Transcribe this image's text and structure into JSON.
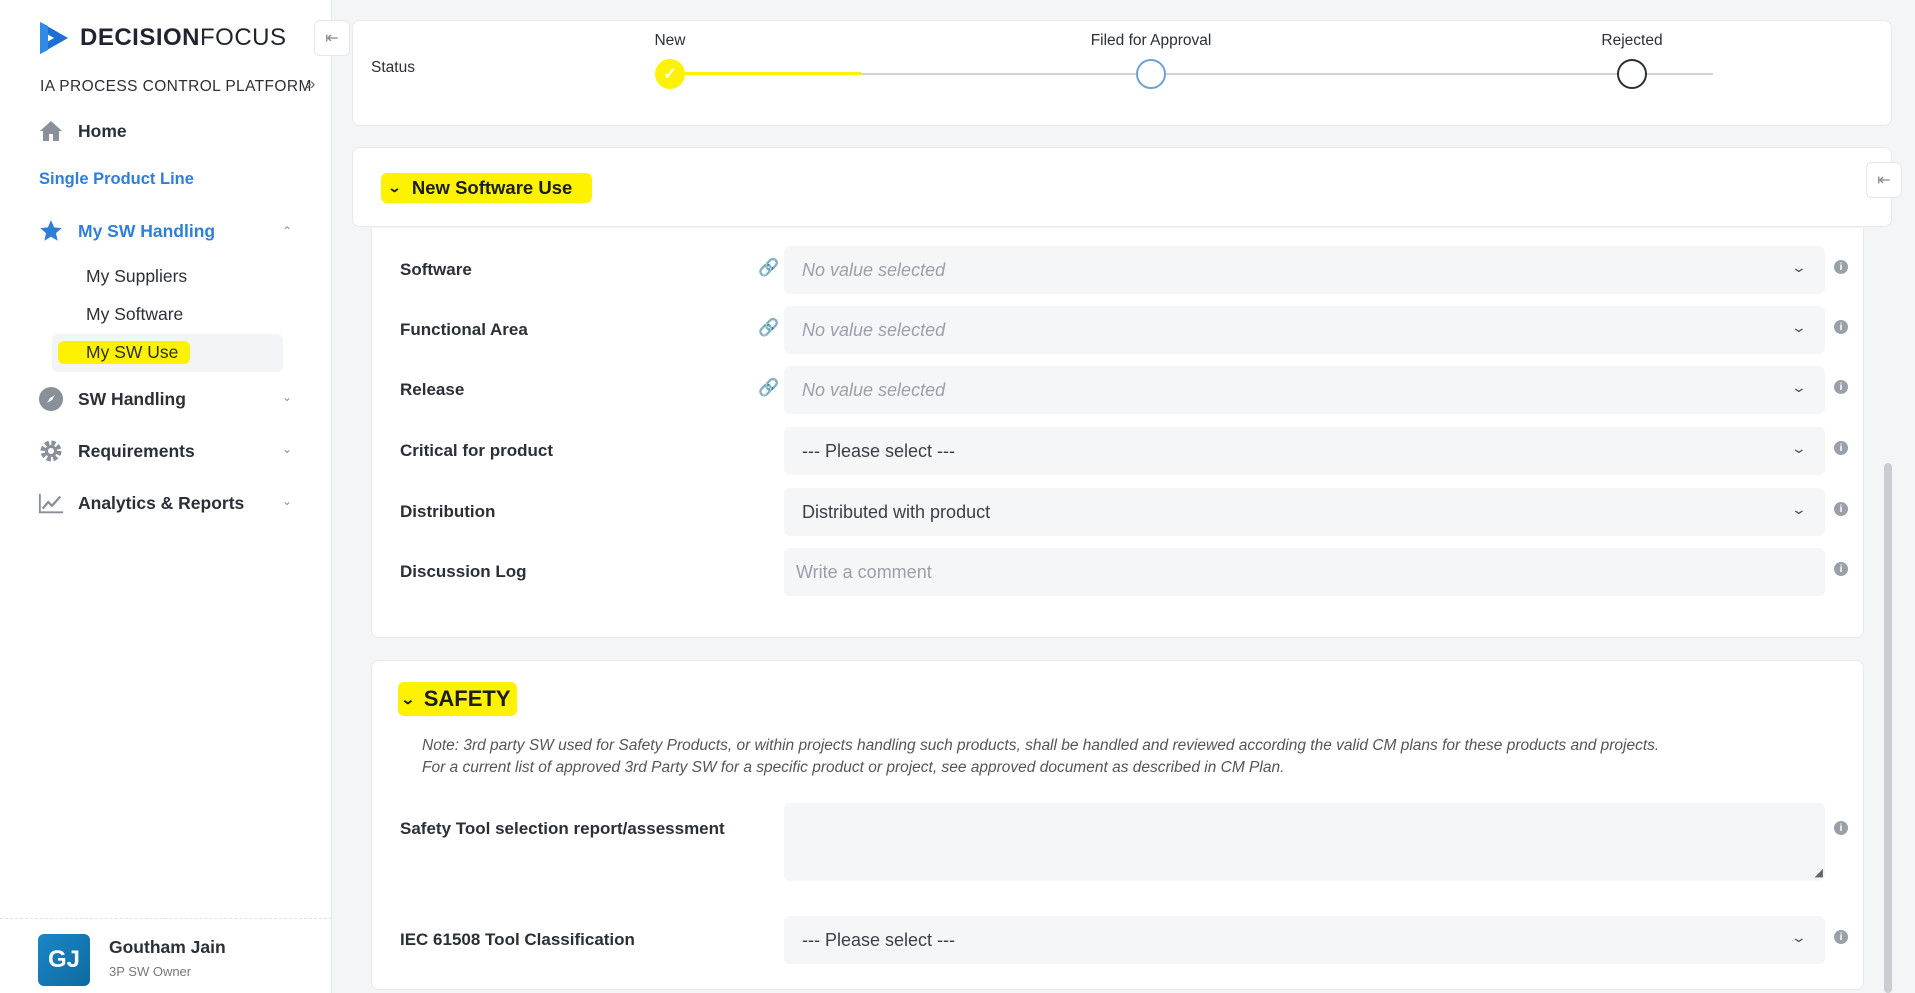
{
  "brand": {
    "bold": "DECISION",
    "light": "FOCUS"
  },
  "sidebar": {
    "platform": "IA PROCESS CONTROL PLATFORM",
    "home": "Home",
    "section_link": "Single Product Line",
    "my_sw_handling": "My SW Handling",
    "sub_items": [
      "My Suppliers",
      "My Software",
      "My SW Use"
    ],
    "sw_handling": "SW Handling",
    "requirements": "Requirements",
    "analytics": "Analytics & Reports"
  },
  "user": {
    "initials": "GJ",
    "name": "Goutham Jain",
    "role": "3P SW Owner"
  },
  "status": {
    "label": "Status",
    "steps": [
      "New",
      "Filed for Approval",
      "Rejected"
    ],
    "current_step": 0
  },
  "section": {
    "title": "New Software Use"
  },
  "form": {
    "software": {
      "label": "Software",
      "value": "No value selected"
    },
    "functional_area": {
      "label": "Functional Area",
      "value": "No value selected"
    },
    "release": {
      "label": "Release",
      "value": "No value selected"
    },
    "critical": {
      "label": "Critical for product",
      "value": "--- Please select ---"
    },
    "distribution": {
      "label": "Distribution",
      "value": "Distributed with product"
    },
    "discussion": {
      "label": "Discussion Log",
      "placeholder": "Write a comment"
    }
  },
  "safety": {
    "title": "SAFETY",
    "note_line1": "Note: 3rd party SW used for Safety Products, or within projects handling such products, shall be handled and reviewed according the valid CM plans for these products and projects.",
    "note_line2": "For a current list of approved 3rd Party SW for a specific product or project, see approved document as described in CM Plan.",
    "report_label": "Safety Tool selection report/assessment",
    "iec_label": "IEC 61508 Tool Classification",
    "iec_value": "--- Please select ---"
  },
  "colors": {
    "highlight": "#fff200",
    "accent": "#2f7ed8"
  }
}
